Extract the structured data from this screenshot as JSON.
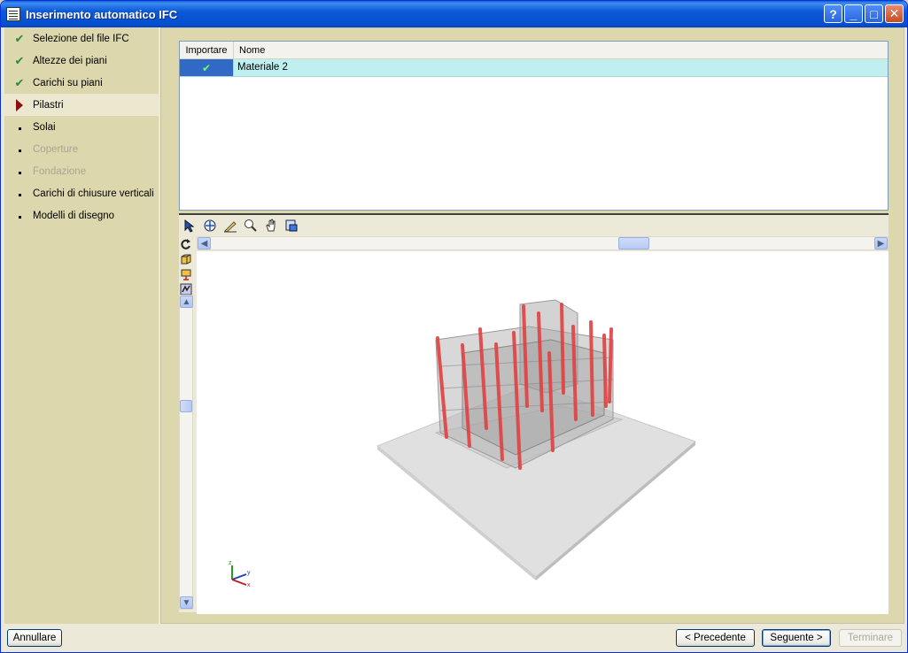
{
  "window": {
    "title": "Inserimento automatico IFC"
  },
  "titlebar_buttons": {
    "help": "?",
    "minimize": "_",
    "maximize": "□",
    "close": "✕"
  },
  "steps": [
    {
      "label": "Selezione del file IFC",
      "state": "done"
    },
    {
      "label": "Altezze dei piani",
      "state": "done"
    },
    {
      "label": "Carichi su piani",
      "state": "done"
    },
    {
      "label": "Pilastri",
      "state": "current"
    },
    {
      "label": "Solai",
      "state": "todo"
    },
    {
      "label": "Coperture",
      "state": "disabled"
    },
    {
      "label": "Fondazione",
      "state": "disabled"
    },
    {
      "label": "Carichi di chiusure verticali",
      "state": "todo"
    },
    {
      "label": "Modelli di disegno",
      "state": "todo"
    }
  ],
  "table": {
    "columns": [
      "Importare",
      "Nome"
    ],
    "rows": [
      {
        "import": "✔",
        "name": "Materiale 2"
      }
    ]
  },
  "viewer": {
    "toolbar_icons": [
      "select-icon",
      "zoom-extents-icon",
      "pen-icon",
      "zoom-window-icon",
      "pan-hand-icon",
      "export-icon"
    ],
    "side_icons": [
      "rotate-icon",
      "view-3d-icon",
      "view-plan-icon",
      "render-icon"
    ],
    "axes": {
      "x": "x",
      "y": "y",
      "z": "z"
    }
  },
  "buttons": {
    "cancel": "Annullare",
    "previous": "< Precedente",
    "next": "Seguente >",
    "finish": "Terminare"
  },
  "colors": {
    "column": "#e04040",
    "selection": "#316ac5",
    "row": "#bfefef"
  }
}
